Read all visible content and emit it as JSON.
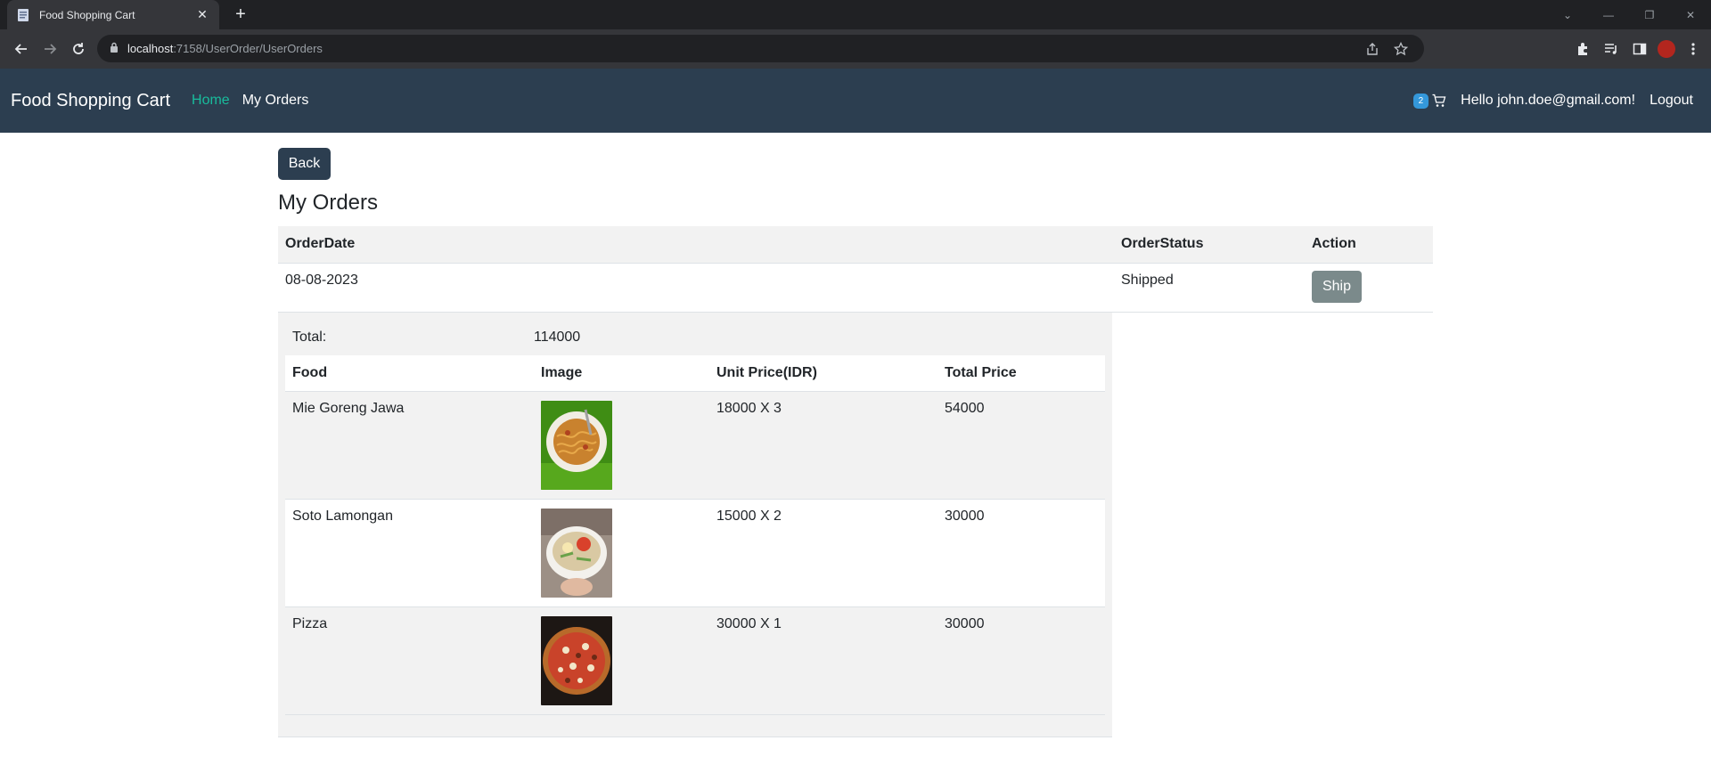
{
  "browser": {
    "tab_title": "Food Shopping Cart",
    "url_host": "localhost",
    "url_path": ":7158/UserOrder/UserOrders"
  },
  "navbar": {
    "brand": "Food Shopping Cart",
    "links": [
      "Home",
      "My Orders"
    ],
    "cart_count": "2",
    "greeting": "Hello john.doe@gmail.com!",
    "logout": "Logout"
  },
  "page": {
    "back_label": "Back",
    "title": "My Orders"
  },
  "orders_table": {
    "headers": [
      "OrderDate",
      "OrderStatus",
      "Action"
    ],
    "rows": [
      {
        "date": "08-08-2023",
        "status": "Shipped",
        "action": "Ship"
      }
    ]
  },
  "order_details": {
    "total_label": "Total:",
    "total_value": "114000",
    "headers": [
      "Food",
      "Image",
      "Unit Price(IDR)",
      "Total Price"
    ],
    "items": [
      {
        "food": "Mie Goreng Jawa",
        "unit_price": "18000 X 3",
        "total_price": "54000",
        "image": "mie-goreng-image"
      },
      {
        "food": "Soto Lamongan",
        "unit_price": "15000 X 2",
        "total_price": "30000",
        "image": "soto-image"
      },
      {
        "food": "Pizza",
        "unit_price": "30000 X 1",
        "total_price": "30000",
        "image": "pizza-image"
      }
    ]
  },
  "colors": {
    "navbar_bg": "#2c3e50",
    "link_active": "#18bc9c",
    "badge": "#3498db",
    "ship_button": "#7b8a8b"
  }
}
